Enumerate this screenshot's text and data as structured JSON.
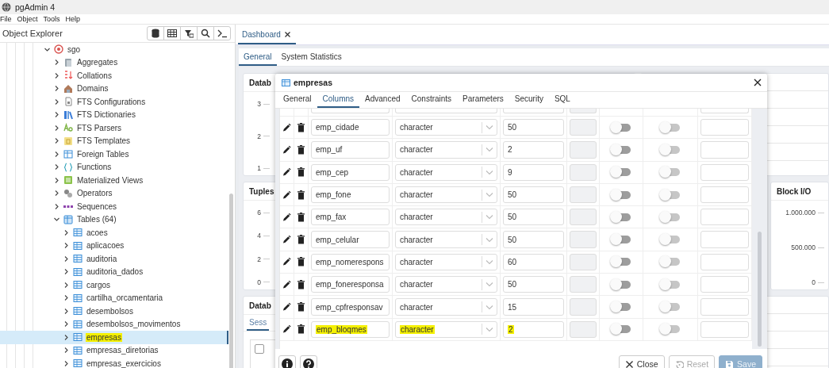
{
  "window": {
    "title": "pgAdmin 4"
  },
  "menu": [
    "File",
    "Object",
    "Tools",
    "Help"
  ],
  "explorer": {
    "title": "Object Explorer",
    "tree": [
      {
        "label": "sgo",
        "kind": "database",
        "expanded": true,
        "selected": false,
        "highlighted": false,
        "children": [
          {
            "label": "Aggregates",
            "kind": "aggregates",
            "expanded": false,
            "selected": false,
            "highlighted": false
          },
          {
            "label": "Collations",
            "kind": "collations",
            "expanded": false,
            "selected": false,
            "highlighted": false
          },
          {
            "label": "Domains",
            "kind": "domains",
            "expanded": false,
            "selected": false,
            "highlighted": false
          },
          {
            "label": "FTS Configurations",
            "kind": "ftsconfig",
            "expanded": false,
            "selected": false,
            "highlighted": false
          },
          {
            "label": "FTS Dictionaries",
            "kind": "ftsdict",
            "expanded": false,
            "selected": false,
            "highlighted": false
          },
          {
            "label": "FTS Parsers",
            "kind": "ftsparser",
            "expanded": false,
            "selected": false,
            "highlighted": false
          },
          {
            "label": "FTS Templates",
            "kind": "ftstemplate",
            "expanded": false,
            "selected": false,
            "highlighted": false
          },
          {
            "label": "Foreign Tables",
            "kind": "foreigntable",
            "expanded": false,
            "selected": false,
            "highlighted": false
          },
          {
            "label": "Functions",
            "kind": "function",
            "expanded": false,
            "selected": false,
            "highlighted": false
          },
          {
            "label": "Materialized Views",
            "kind": "matview",
            "expanded": false,
            "selected": false,
            "highlighted": false
          },
          {
            "label": "Operators",
            "kind": "operator",
            "expanded": false,
            "selected": false,
            "highlighted": false
          },
          {
            "label": "Sequences",
            "kind": "sequence",
            "expanded": false,
            "selected": false,
            "highlighted": false
          },
          {
            "label": "Tables (64)",
            "kind": "tables",
            "expanded": true,
            "selected": false,
            "highlighted": false,
            "children": [
              {
                "label": "acoes",
                "kind": "table",
                "expanded": false,
                "selected": false,
                "highlighted": false
              },
              {
                "label": "aplicacoes",
                "kind": "table",
                "expanded": false,
                "selected": false,
                "highlighted": false
              },
              {
                "label": "auditoria",
                "kind": "table",
                "expanded": false,
                "selected": false,
                "highlighted": false
              },
              {
                "label": "auditoria_dados",
                "kind": "table",
                "expanded": false,
                "selected": false,
                "highlighted": false
              },
              {
                "label": "cargos",
                "kind": "table",
                "expanded": false,
                "selected": false,
                "highlighted": false
              },
              {
                "label": "cartilha_orcamentaria",
                "kind": "table",
                "expanded": false,
                "selected": false,
                "highlighted": false
              },
              {
                "label": "desembolsos",
                "kind": "table",
                "expanded": false,
                "selected": false,
                "highlighted": false
              },
              {
                "label": "desembolsos_movimentos",
                "kind": "table",
                "expanded": false,
                "selected": false,
                "highlighted": false
              },
              {
                "label": "empresas",
                "kind": "table",
                "expanded": false,
                "selected": true,
                "highlighted": true
              },
              {
                "label": "empresas_diretorias",
                "kind": "table",
                "expanded": false,
                "selected": false,
                "highlighted": false
              },
              {
                "label": "empresas_exercicios",
                "kind": "table",
                "expanded": false,
                "selected": false,
                "highlighted": false
              }
            ]
          }
        ]
      }
    ]
  },
  "dashboard": {
    "tab": {
      "label": "Dashboard",
      "selected": true
    },
    "subtabs": [
      {
        "label": "General",
        "selected": true
      },
      {
        "label": "System Statistics",
        "selected": false
      }
    ],
    "rows": [
      {
        "panels": [
          {
            "kind": "chart",
            "title": "Datab",
            "ticks": [
              "3",
              "2",
              "1"
            ]
          },
          {
            "kind": "table"
          }
        ]
      },
      {
        "panels": [
          {
            "kind": "chart",
            "title": "Tuples",
            "ticks": [
              "6",
              "4",
              "2",
              "0"
            ]
          },
          {
            "kind": "chart",
            "title": "Block I/O",
            "ticks": [
              "1.000.000",
              "500.000",
              "0"
            ]
          }
        ]
      },
      {
        "panels": [
          {
            "kind": "tabs",
            "title": "Datab",
            "tabs": [
              {
                "label": "Sess",
                "selected": true
              }
            ],
            "checked": false
          },
          {
            "kind": "table"
          }
        ]
      }
    ]
  },
  "dialog": {
    "title": "empresas",
    "tabs": [
      {
        "label": "General",
        "selected": false
      },
      {
        "label": "Columns",
        "selected": true
      },
      {
        "label": "Advanced",
        "selected": false
      },
      {
        "label": "Constraints",
        "selected": false
      },
      {
        "label": "Parameters",
        "selected": false
      },
      {
        "label": "Security",
        "selected": false
      },
      {
        "label": "SQL",
        "selected": false
      }
    ],
    "columns": [
      {
        "name": "emp_cidade",
        "type": "character",
        "length": "50",
        "not_null": false,
        "primary_key": false,
        "highlighted": false
      },
      {
        "name": "emp_uf",
        "type": "character",
        "length": "2",
        "not_null": false,
        "primary_key": false,
        "highlighted": false
      },
      {
        "name": "emp_cep",
        "type": "character",
        "length": "9",
        "not_null": false,
        "primary_key": false,
        "highlighted": false
      },
      {
        "name": "emp_fone",
        "type": "character",
        "length": "50",
        "not_null": false,
        "primary_key": false,
        "highlighted": false
      },
      {
        "name": "emp_fax",
        "type": "character",
        "length": "50",
        "not_null": false,
        "primary_key": false,
        "highlighted": false
      },
      {
        "name": "emp_celular",
        "type": "character",
        "length": "50",
        "not_null": false,
        "primary_key": false,
        "highlighted": false
      },
      {
        "name": "emp_nomerespons",
        "type": "character",
        "length": "60",
        "not_null": false,
        "primary_key": false,
        "highlighted": false
      },
      {
        "name": "emp_foneresponsa",
        "type": "character",
        "length": "50",
        "not_null": false,
        "primary_key": false,
        "highlighted": false
      },
      {
        "name": "emp_cpfresponsav",
        "type": "character",
        "length": "15",
        "not_null": false,
        "primary_key": false,
        "highlighted": false
      },
      {
        "name": "emp_bloqmes",
        "type": "character",
        "length": "2",
        "not_null": false,
        "primary_key": false,
        "highlighted": true
      }
    ],
    "buttons": [
      {
        "label": "Close",
        "kind": "close",
        "disabled": false
      },
      {
        "label": "Reset",
        "kind": "reset",
        "disabled": true
      },
      {
        "label": "Save",
        "kind": "save",
        "disabled": true
      }
    ]
  }
}
